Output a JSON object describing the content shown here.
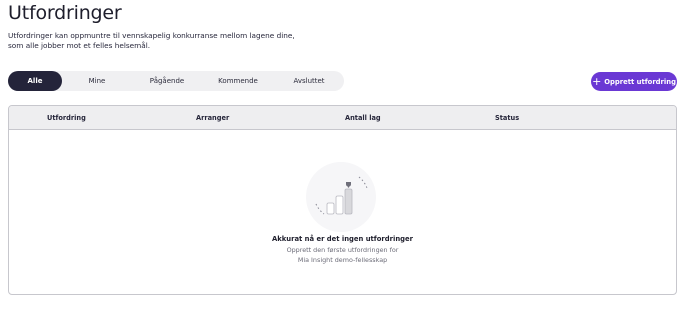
{
  "page": {
    "title": "Utfordringer",
    "description_line1": "Utfordringer kan oppmuntre til vennskapelig konkurranse mellom lagene dine,",
    "description_line2": "som alle jobber mot et felles helsemål."
  },
  "filters": {
    "tabs": [
      "Alle",
      "Mine",
      "Pågående",
      "Kommende",
      "Avsluttet"
    ],
    "active": "Alle"
  },
  "create_button": {
    "label": "Opprett utfordring",
    "icon": "plus-icon"
  },
  "table": {
    "columns": [
      "Utfordring",
      "Arranger",
      "Antall lag",
      "Status"
    ],
    "rows": []
  },
  "empty_state": {
    "icon": "bar-chart-trophy-icon",
    "title": "Akkurat nå er det ingen utfordringer",
    "subtitle_line1": "Opprett den første utfordringen for",
    "subtitle_line2": "Mia Insight demo-fellesskap"
  },
  "colors": {
    "accent": "#6a38d4",
    "active_tab": "#24243a",
    "tab_bar": "#f0f0f2",
    "table_header": "#eeeef0",
    "border": "#c7c7cd"
  }
}
